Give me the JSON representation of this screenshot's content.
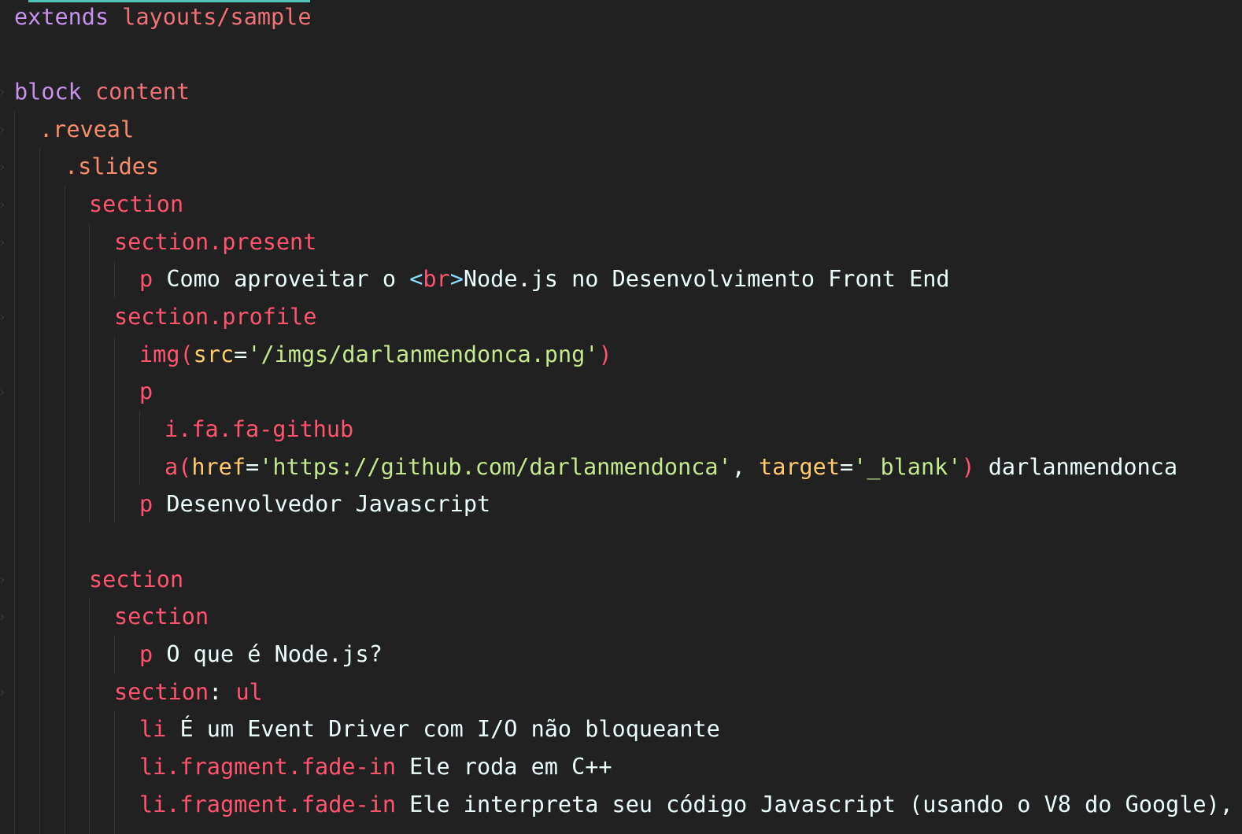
{
  "editor": {
    "language": "pug",
    "colors": {
      "background": "#212121",
      "keyword": "#c792ea",
      "tag": "#ff5370",
      "class_selector": "#f78c6c",
      "attribute": "#ffcb6b",
      "string": "#c3e88d",
      "punctuation": "#89ddff",
      "text": "#eeffff",
      "active_tab_indicator": "#4fc3b4"
    },
    "lines": [
      {
        "tokens": [
          {
            "t": "extends",
            "k": "kw"
          },
          {
            "t": " ",
            "k": "plain"
          },
          {
            "t": "layouts/sample",
            "k": "id"
          }
        ]
      },
      {
        "tokens": []
      },
      {
        "tokens": [
          {
            "t": "block",
            "k": "kw"
          },
          {
            "t": " ",
            "k": "plain"
          },
          {
            "t": "content",
            "k": "id"
          }
        ]
      },
      {
        "tokens": [
          {
            "t": ".reveal",
            "k": "cls"
          }
        ]
      },
      {
        "tokens": [
          {
            "t": ".slides",
            "k": "cls"
          }
        ]
      },
      {
        "tokens": [
          {
            "t": "section",
            "k": "tag"
          }
        ]
      },
      {
        "tokens": [
          {
            "t": "section.present",
            "k": "tag"
          }
        ]
      },
      {
        "tokens": [
          {
            "t": "p",
            "k": "tag"
          },
          {
            "t": " Como aproveitar o ",
            "k": "text"
          },
          {
            "t": "<",
            "k": "punc"
          },
          {
            "t": "br",
            "k": "tag"
          },
          {
            "t": ">",
            "k": "punc"
          },
          {
            "t": "Node.js no Desenvolvimento Front End",
            "k": "text"
          }
        ]
      },
      {
        "tokens": [
          {
            "t": "section.profile",
            "k": "tag"
          }
        ]
      },
      {
        "tokens": [
          {
            "t": "img",
            "k": "tag"
          },
          {
            "t": "(",
            "k": "paren"
          },
          {
            "t": "src",
            "k": "attr"
          },
          {
            "t": "=",
            "k": "plain"
          },
          {
            "t": "'/imgs/darlanmendonca.png'",
            "k": "str"
          },
          {
            "t": ")",
            "k": "paren"
          }
        ]
      },
      {
        "tokens": [
          {
            "t": "p",
            "k": "tag"
          }
        ]
      },
      {
        "tokens": [
          {
            "t": "i.fa.fa-github",
            "k": "tag"
          }
        ]
      },
      {
        "tokens": [
          {
            "t": "a",
            "k": "tag"
          },
          {
            "t": "(",
            "k": "paren"
          },
          {
            "t": "href",
            "k": "attr"
          },
          {
            "t": "=",
            "k": "plain"
          },
          {
            "t": "'https://github.com/darlanmendonca'",
            "k": "str"
          },
          {
            "t": ", ",
            "k": "plain"
          },
          {
            "t": "target",
            "k": "attr"
          },
          {
            "t": "=",
            "k": "plain"
          },
          {
            "t": "'_blank'",
            "k": "str"
          },
          {
            "t": ")",
            "k": "paren"
          },
          {
            "t": " darlanmendonca",
            "k": "text"
          }
        ]
      },
      {
        "tokens": [
          {
            "t": "p",
            "k": "tag"
          },
          {
            "t": " Desenvolvedor Javascript",
            "k": "text"
          }
        ]
      },
      {
        "tokens": []
      },
      {
        "tokens": [
          {
            "t": "section",
            "k": "tag"
          }
        ]
      },
      {
        "tokens": [
          {
            "t": "section",
            "k": "tag"
          }
        ]
      },
      {
        "tokens": [
          {
            "t": "p",
            "k": "tag"
          },
          {
            "t": " O que é Node.js?",
            "k": "text"
          }
        ]
      },
      {
        "tokens": [
          {
            "t": "section",
            "k": "tag"
          },
          {
            "t": ": ",
            "k": "plain"
          },
          {
            "t": "ul",
            "k": "tag"
          }
        ]
      },
      {
        "tokens": [
          {
            "t": "li",
            "k": "tag"
          },
          {
            "t": " É um Event Driver com I/O não bloqueante",
            "k": "text"
          }
        ]
      },
      {
        "tokens": [
          {
            "t": "li.fragment.fade-in",
            "k": "tag"
          },
          {
            "t": " Ele roda em C++",
            "k": "text"
          }
        ]
      },
      {
        "tokens": [
          {
            "t": "li.fragment.fade-in",
            "k": "tag"
          },
          {
            "t": " Ele interpreta seu código Javascript (usando o V8 do Google),",
            "k": "text"
          }
        ]
      }
    ]
  }
}
